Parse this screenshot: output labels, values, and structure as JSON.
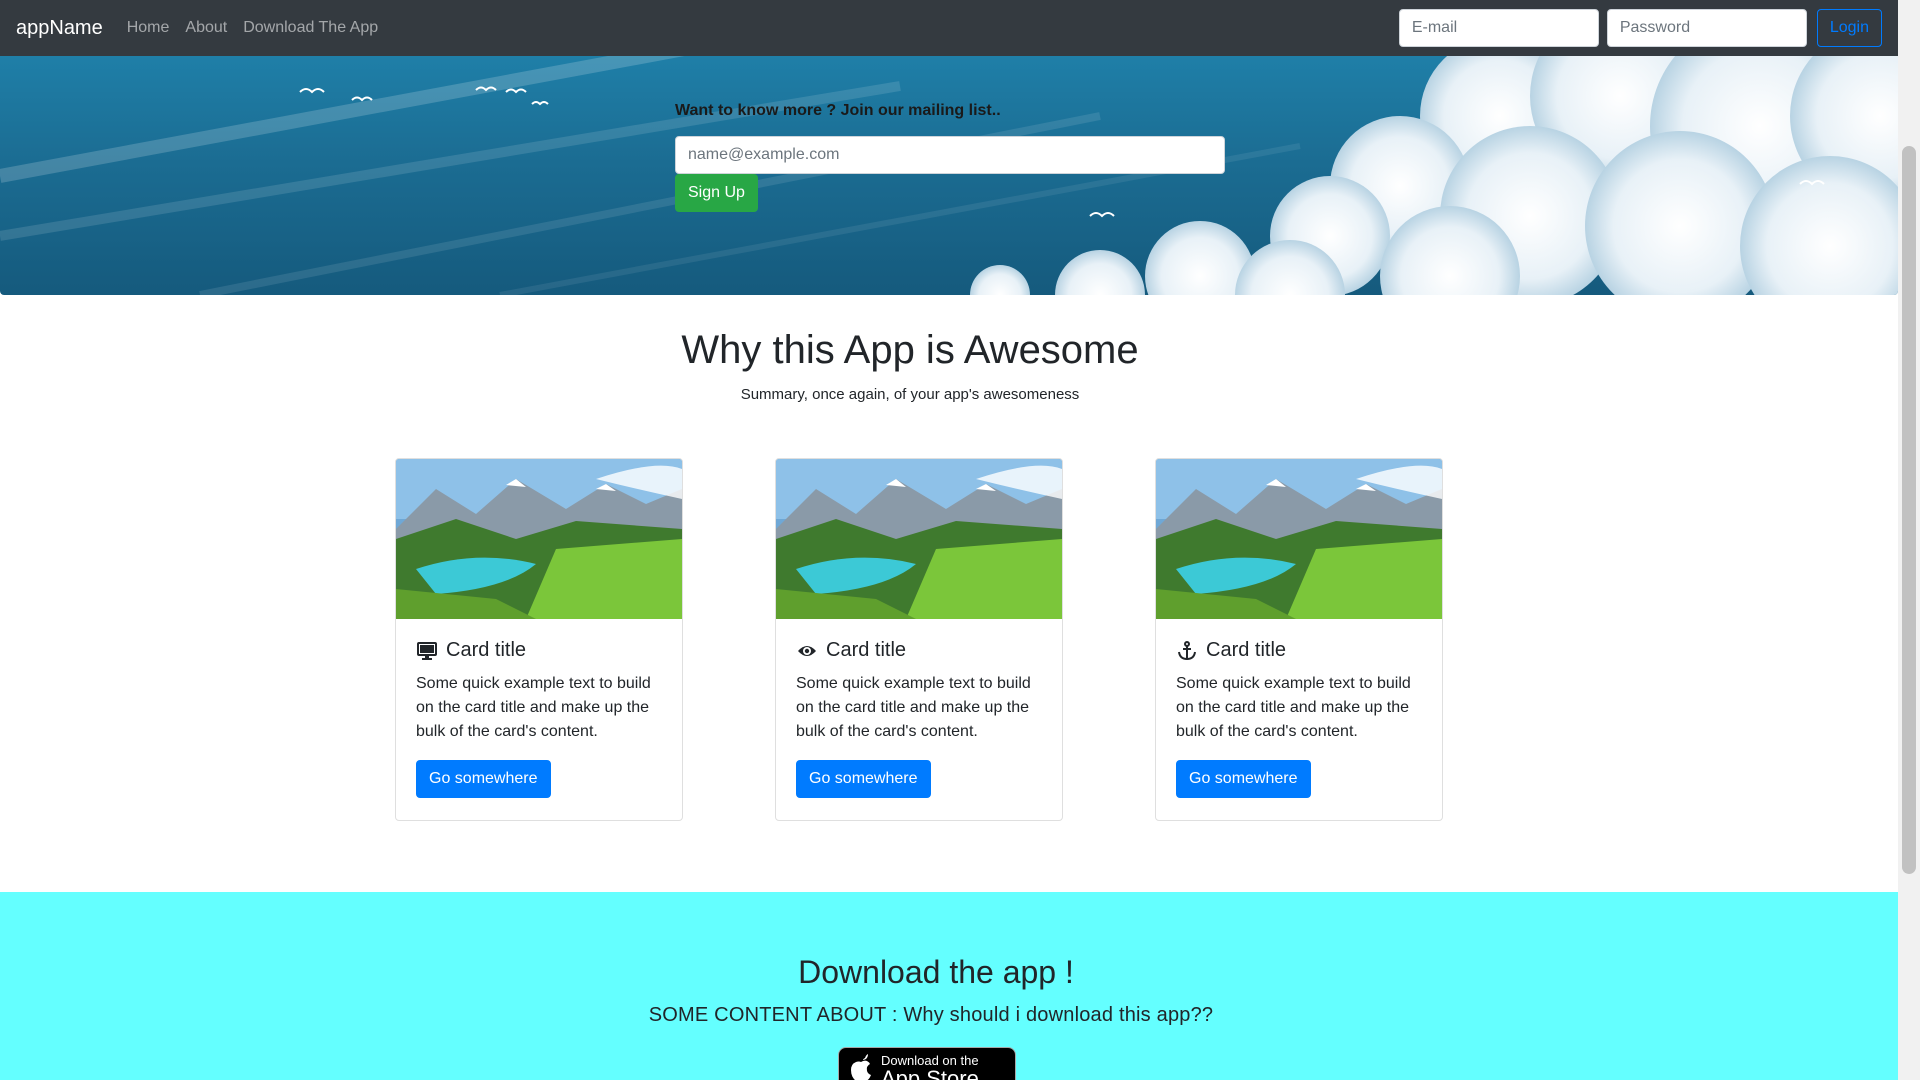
{
  "navbar": {
    "brand": "appName",
    "links": [
      "Home",
      "About",
      "Download The App"
    ],
    "email_placeholder": "E-mail",
    "password_placeholder": "Password",
    "login_label": "Login"
  },
  "hero": {
    "label": "Want to know more ? Join our mailing list..",
    "input_placeholder": "name@example.com",
    "signup_label": "Sign Up"
  },
  "features": {
    "title": "Why this App is Awesome",
    "subtitle": "Summary, once again, of your app's awesomeness",
    "cards": [
      {
        "icon": "desktop-icon",
        "title": "Card title",
        "text": "Some quick example text to build on the card title and make up the bulk of the card's content.",
        "button": "Go somewhere"
      },
      {
        "icon": "eye-icon",
        "title": "Card title",
        "text": "Some quick example text to build on the card title and make up the bulk of the card's content.",
        "button": "Go somewhere"
      },
      {
        "icon": "anchor-icon",
        "title": "Card title",
        "text": "Some quick example text to build on the card title and make up the bulk of the card's content.",
        "button": "Go somewhere"
      }
    ]
  },
  "download": {
    "title": "Download the app !",
    "subtitle": "SOME CONTENT ABOUT : Why should i download this app??",
    "badge_small": "Download on the",
    "badge_big": "App Store"
  },
  "colors": {
    "navbar_bg": "#343a40",
    "primary": "#007bff",
    "success": "#28a745",
    "download_bg": "#64ffff"
  }
}
